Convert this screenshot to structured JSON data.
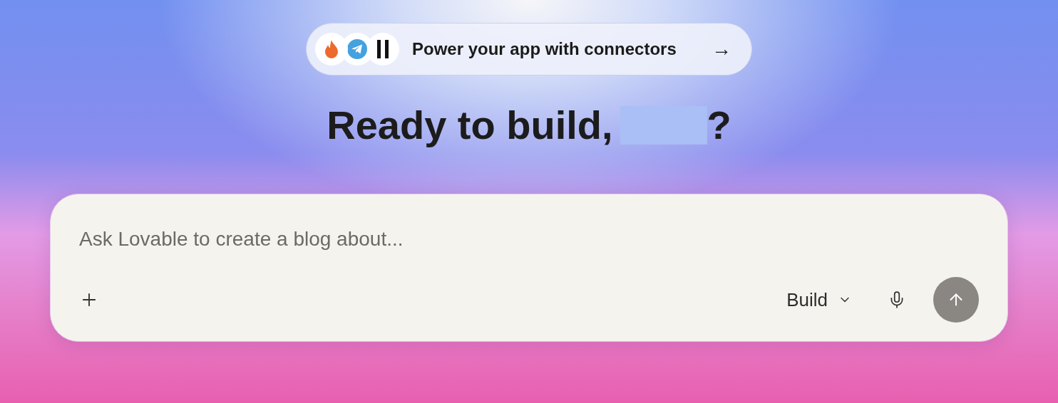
{
  "banner": {
    "label": "Power your app with connectors",
    "arrow": "→"
  },
  "heading": {
    "text": "Ready to build,",
    "name_hidden": true,
    "end": "?"
  },
  "prompt": {
    "placeholder": "Ask Lovable to create a blog about...",
    "mode": "Build",
    "send_disabled": true
  }
}
